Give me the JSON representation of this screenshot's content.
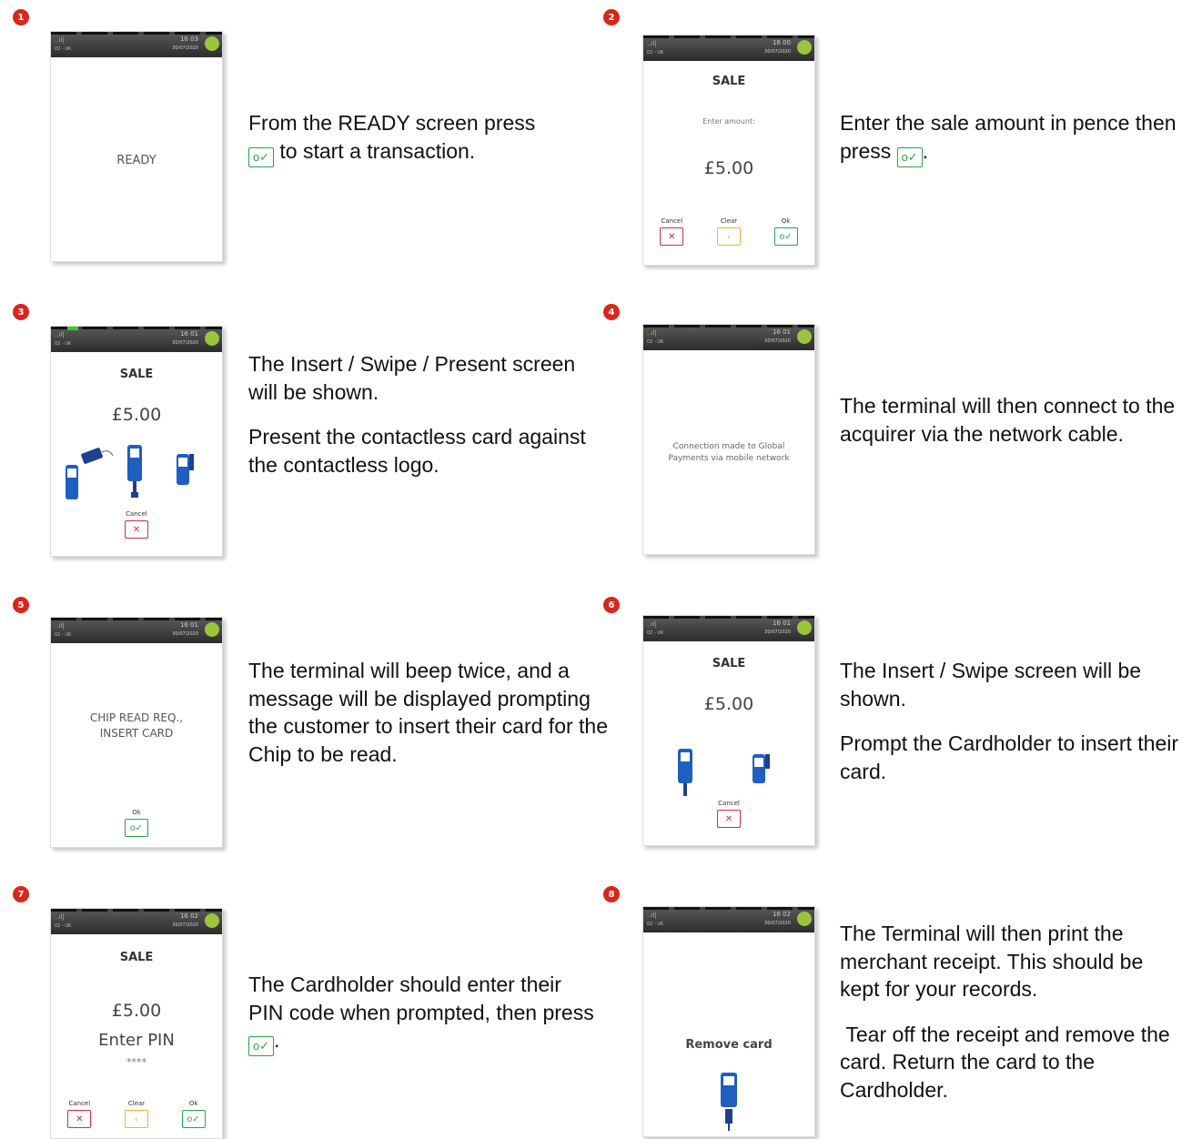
{
  "status_bar": {
    "signal": "..ıl|",
    "network": "02 - UK",
    "date": "30/07/2020"
  },
  "steps": [
    {
      "number": "1",
      "screen": {
        "time": "16 03",
        "text": "READY"
      },
      "text_before": "From the READY screen press",
      "text_after": " to start a transaction."
    },
    {
      "number": "2",
      "screen": {
        "time": "16 00",
        "title": "SALE",
        "prompt": "Enter amount:",
        "amount": "£5.00",
        "keys": {
          "cancel": "Cancel",
          "clear": "Clear",
          "ok": "Ok"
        }
      },
      "text_before": "Enter the sale amount in pence then press",
      "text_after": "."
    },
    {
      "number": "3",
      "screen": {
        "time": "16 01",
        "title": "SALE",
        "amount": "£5.00",
        "cancel": "Cancel"
      },
      "paragraph1": "The Insert / Swipe / Present screen will be shown.",
      "paragraph2": "Present the contactless card against the contactless logo."
    },
    {
      "number": "4",
      "screen": {
        "time": "16 01",
        "message": "Connection made to Global Payments via mobile network"
      },
      "paragraph1": "The terminal will then connect to the acquirer via the network cable."
    },
    {
      "number": "5",
      "screen": {
        "time": "16 01",
        "message_line1": "CHIP READ REQ.,",
        "message_line2": "INSERT CARD",
        "ok": "Ok"
      },
      "paragraph1": "The terminal will beep twice, and a message will be displayed prompting the customer to insert their card for the Chip to be read."
    },
    {
      "number": "6",
      "screen": {
        "time": "16 01",
        "title": "SALE",
        "amount": "£5.00",
        "cancel": "Cancel"
      },
      "paragraph1": "The Insert / Swipe screen will be shown.",
      "paragraph2": "Prompt the Cardholder to insert their card."
    },
    {
      "number": "7",
      "screen": {
        "time": "16 02",
        "title": "SALE",
        "amount": "£5.00",
        "prompt": "Enter PIN",
        "pin": "****",
        "keys": {
          "cancel": "Cancel",
          "clear": "Clear",
          "ok": "Ok"
        }
      },
      "text_before": "The Cardholder should enter their PIN code when prompted, then press",
      "text_after": "."
    },
    {
      "number": "8",
      "screen": {
        "time": "16 02",
        "message": "Remove card"
      },
      "paragraph1": "The Terminal will then print the merchant receipt. This should be kept for your records.",
      "paragraph2": " Tear off the receipt and remove the card. Return the card to the Cardholder."
    }
  ]
}
